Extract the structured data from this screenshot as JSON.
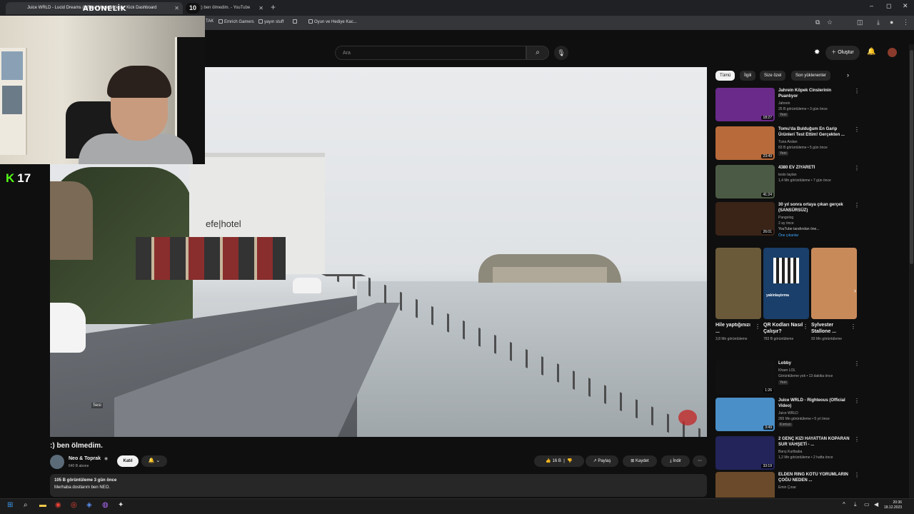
{
  "browser": {
    "tabs": [
      {
        "label": "Juice WRLD - Lucid Dreams (Official Music Video) - Kick Dashboard",
        "active": true
      },
      {
        "label": ":) ben ölmedim. - YouTube",
        "active": false
      }
    ],
    "new_tab": "+",
    "window_controls": [
      "–",
      "◻",
      "✕"
    ],
    "bookmarks": [
      "TAK",
      "Emrich Gamers",
      "yayın stuff",
      "",
      "Oyun ve Hediye Kac..."
    ]
  },
  "stream_overlay": {
    "sub_label": "ABONELİK",
    "sub_count": "10",
    "kick_count": "17"
  },
  "youtube_header": {
    "search_placeholder": "Ara",
    "create_label": "Oluştur"
  },
  "video": {
    "hotel_sign": "efe|hotel",
    "tiny_label": "Sesi",
    "title": ":) ben ölmedim.",
    "channel_name": "Neo & Toprak",
    "channel_subs": "640 B abone",
    "join_label": "Katıl",
    "like_count": "16 B",
    "share_label": "Paylaş",
    "save_label": "Kaydet",
    "download_label": "İndir",
    "desc_meta": "105 B görüntüleme  3 gün önce",
    "desc_text": "Merhaba dostlarım ben NEO."
  },
  "sidebar": {
    "chips": [
      "Tümü",
      "İlgili",
      "Size özel",
      "Son yüklenenler"
    ],
    "recs_top": [
      {
        "title": "Jahrein Köpek Cinslerinin Puanlıyor",
        "channel": "Jahrein",
        "views": "25 B görüntüleme • 3 gün önce",
        "new": "Yeni",
        "duration": "18:27",
        "thumb": "#6a2a8a"
      },
      {
        "title": "Tomu'da Bulduğum En Garip Ürünleri Test Ettim! Gerçekten ...",
        "channel": "Tuna Arslan",
        "views": "83 B görüntüleme • 5 gün önce",
        "new": "Yeni",
        "duration": "23:49",
        "thumb": "#b86a3b"
      },
      {
        "title": "4380 EV ZİYARETİ",
        "channel": "testo taylan",
        "views": "1,4 Mn görüntüleme • 7 gün önce",
        "new": "",
        "duration": "41:24",
        "thumb": "#4b5a44"
      },
      {
        "title": "30 yıl sonra ortaya çıkan gerçek (SANSÜRSÜZ)",
        "channel": "Pangolog",
        "views": "2 ay önce",
        "new": "",
        "duration": "26:01",
        "thumb": "#3a2418",
        "extra": "YouTube tarafından öne...",
        "extra2": "Öne çıkanlar"
      }
    ],
    "shorts": [
      {
        "title": "Hile yaptığınızı ...",
        "views": "3,8 Mn görüntüleme",
        "thumb": "#6b5a3a"
      },
      {
        "title": "QR Kodları Nasıl Çalışır?",
        "views": "783 B görüntüleme",
        "thumb": "#1a3f6a",
        "overlay": "yakinlaştırma"
      },
      {
        "title": "Sylvester Stallone ...",
        "views": "93 Mn görüntüleme",
        "thumb": "#c98a5a"
      }
    ],
    "recs_bottom": [
      {
        "title": "Lobby",
        "channel": "Kharn LOL",
        "views": "Görüntüleme yok • 13 dakika önce",
        "new": "Yeni",
        "duration": "1:26",
        "thumb": "#111111"
      },
      {
        "title": "Juice WRLD - Righteous (Official Video)",
        "channel": "Juice WRLD",
        "views": "265 Mn görüntüleme • 5 yıl önce",
        "new": "Kırmızı",
        "duration": "3:49",
        "thumb": "#4a8fc8"
      },
      {
        "title": "2 GENÇ KIZI HAYATTAN KOPARAN SUR VAHŞETİ - ...",
        "channel": "Barış Kurtbaba",
        "views": "1,2 Mn görüntüleme • 2 hafta önce",
        "new": "",
        "duration": "33:19",
        "thumb": "#22245a"
      },
      {
        "title": "ELDEN RING KÖTÜ YORUMLARIN ÇOĞU NEDEN ...",
        "channel": "Emin Çınar",
        "views": "",
        "new": "",
        "duration": "",
        "thumb": "#6a4a2a"
      }
    ]
  },
  "taskbar": {
    "time": "20:36",
    "date": "18.12.2023"
  }
}
